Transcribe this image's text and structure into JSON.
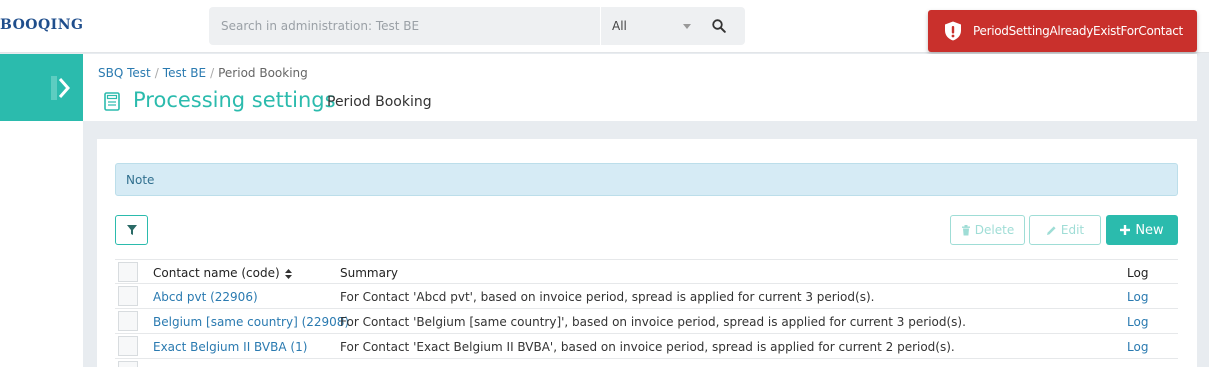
{
  "app": {
    "logo": "BOOQING"
  },
  "search": {
    "placeholder": "Search in administration: Test BE",
    "scope": "All"
  },
  "toast": {
    "message": "PeriodSettingAlreadyExistForContact"
  },
  "breadcrumb": [
    "SBQ Test",
    "Test BE",
    "Period Booking"
  ],
  "page": {
    "title": "Processing settings",
    "subtitle": "Period Booking"
  },
  "note": {
    "label": "Note"
  },
  "toolbar": {
    "delete_label": "Delete",
    "edit_label": "Edit",
    "new_label": "New"
  },
  "table": {
    "headers": {
      "name": "Contact name (code)",
      "summary": "Summary",
      "log": "Log"
    },
    "rows": [
      {
        "name": "Abcd pvt (22906)",
        "summary": "For Contact 'Abcd pvt', based on invoice period, spread is applied for current 3 period(s).",
        "log": "Log"
      },
      {
        "name": "Belgium [same country] (22908)",
        "summary": "For Contact 'Belgium [same country]', based on invoice period, spread is applied for current 3 period(s).",
        "log": "Log"
      },
      {
        "name": "Exact Belgium II BVBA (1)",
        "summary": "For Contact 'Exact Belgium II BVBA', based on invoice period, spread is applied for current 2 period(s).",
        "log": "Log"
      }
    ]
  },
  "colors": {
    "accent": "#2bbbad",
    "link": "#2a7ab0",
    "danger": "#c9302c",
    "note_bg": "#d6ebf5"
  }
}
